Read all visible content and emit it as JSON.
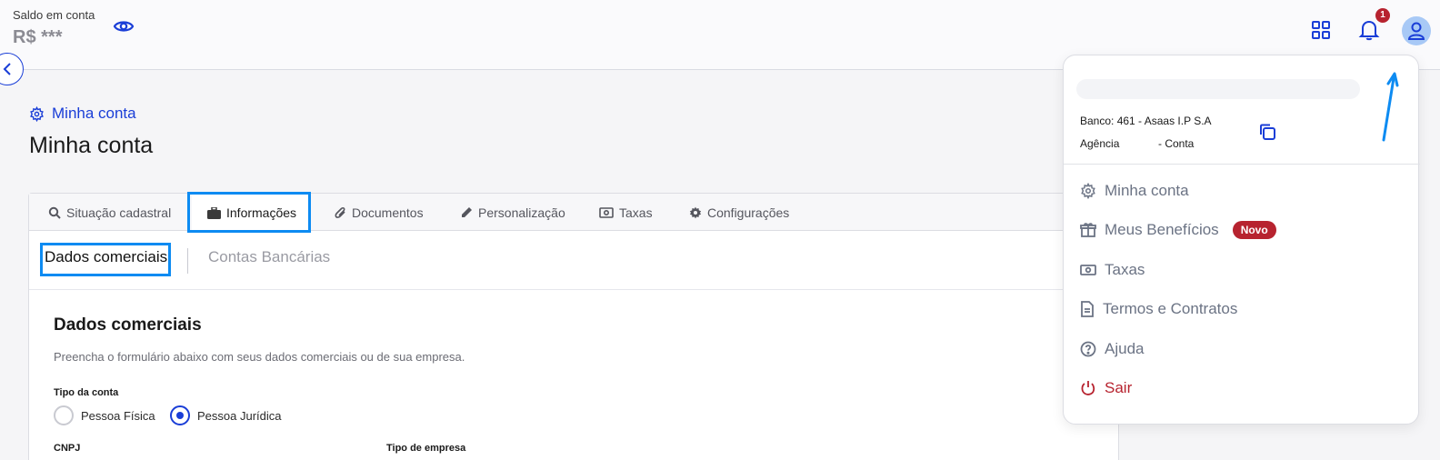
{
  "header": {
    "balance_label": "Saldo em conta",
    "balance_value": "R$ ***",
    "notification_count": "1"
  },
  "breadcrumb": {
    "label": "Minha conta"
  },
  "page": {
    "title": "Minha conta"
  },
  "tabs": [
    {
      "label": "Situação cadastral",
      "icon": "search-icon"
    },
    {
      "label": "Informações",
      "icon": "briefcase-icon",
      "active": true
    },
    {
      "label": "Documentos",
      "icon": "paperclip-icon"
    },
    {
      "label": "Personalização",
      "icon": "pencil-icon"
    },
    {
      "label": "Taxas",
      "icon": "money-icon"
    },
    {
      "label": "Configurações",
      "icon": "gear-icon"
    }
  ],
  "subtabs": [
    {
      "label": "Dados comerciais",
      "active": true
    },
    {
      "label": "Contas Bancárias"
    }
  ],
  "form": {
    "section_title": "Dados comerciais",
    "section_desc": "Preencha o formulário abaixo com seus dados comerciais ou de sua empresa.",
    "account_type_label": "Tipo da conta",
    "options": [
      {
        "label": "Pessoa Física",
        "checked": false
      },
      {
        "label": "Pessoa Jurídica",
        "checked": true
      }
    ],
    "cnpj_label": "CNPJ",
    "company_type_label": "Tipo de empresa"
  },
  "dropdown": {
    "bank": "Banco: 461 - Asaas I.P S.A",
    "agency": "Agência",
    "account": "- Conta",
    "items": [
      {
        "label": "Minha conta",
        "icon": "gear-icon"
      },
      {
        "label": "Meus Benefícios",
        "icon": "gift-icon",
        "badge": "Novo"
      },
      {
        "label": "Taxas",
        "icon": "money-icon"
      },
      {
        "label": "Termos e Contratos",
        "icon": "document-icon"
      },
      {
        "label": "Ajuda",
        "icon": "help-icon"
      },
      {
        "label": "Sair",
        "icon": "power-icon"
      }
    ]
  },
  "colors": {
    "primary": "#1a3ed7",
    "highlight": "#0d8bf2",
    "danger": "#b7232f"
  }
}
